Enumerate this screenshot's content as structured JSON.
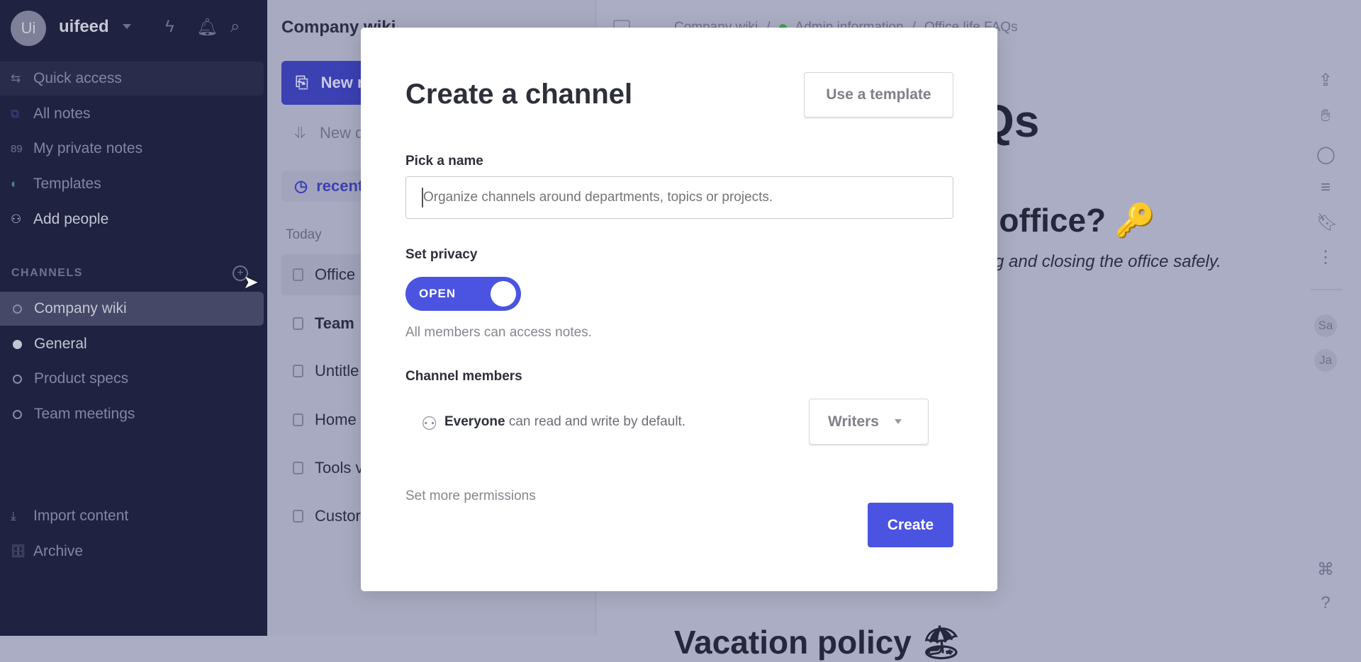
{
  "sidebar": {
    "avatar": "Ui",
    "workspace": "uifeed",
    "items": [
      {
        "label": "Quick access",
        "icon": "arrows-swap-icon"
      },
      {
        "label": "All notes",
        "icon": "notes-stack-icon"
      },
      {
        "label": "My private notes",
        "count": "89"
      },
      {
        "label": "Templates",
        "icon": "templates-icon"
      },
      {
        "label": "Add people",
        "icon": "add-person-icon"
      }
    ],
    "channels_label": "CHANNELS",
    "channels": [
      {
        "label": "Company wiki"
      },
      {
        "label": "General"
      },
      {
        "label": "Product specs"
      },
      {
        "label": "Team meetings"
      }
    ],
    "import": "Import content",
    "archive": "Archive"
  },
  "middle": {
    "title": "Company wiki",
    "new_button": "New n",
    "new_doc": "New d",
    "recent": "recent",
    "today": "Today",
    "notes": [
      "Office",
      "Team",
      "Untitle",
      "Home",
      "Tools v",
      "Custor"
    ]
  },
  "main": {
    "breadcrumb": [
      "Company wiki",
      "Admin information",
      "Office life FAQs"
    ],
    "title_fragment": "Qs",
    "heading_fragment": "e office? 🔑",
    "italic_fragment": "ning and closing the office safely.",
    "bottom_heading": "Vacation policy 🏖",
    "avatars": [
      "Sa",
      "Ja"
    ]
  },
  "modal": {
    "title": "Create a channel",
    "use_template": "Use a template",
    "name_label": "Pick a name",
    "name_value": "",
    "name_placeholder": "Organize channels around departments, topics or projects.",
    "privacy_label": "Set privacy",
    "privacy_toggle": "OPEN",
    "privacy_hint": "All members can access notes.",
    "members_label": "Channel members",
    "everyone": "Everyone",
    "everyone_rest": "can read and write by default.",
    "role": "Writers",
    "more_permissions": "Set more permissions",
    "create": "Create"
  },
  "colors": {
    "accent": "#4a54e1",
    "sidebar": "#1f2240"
  }
}
